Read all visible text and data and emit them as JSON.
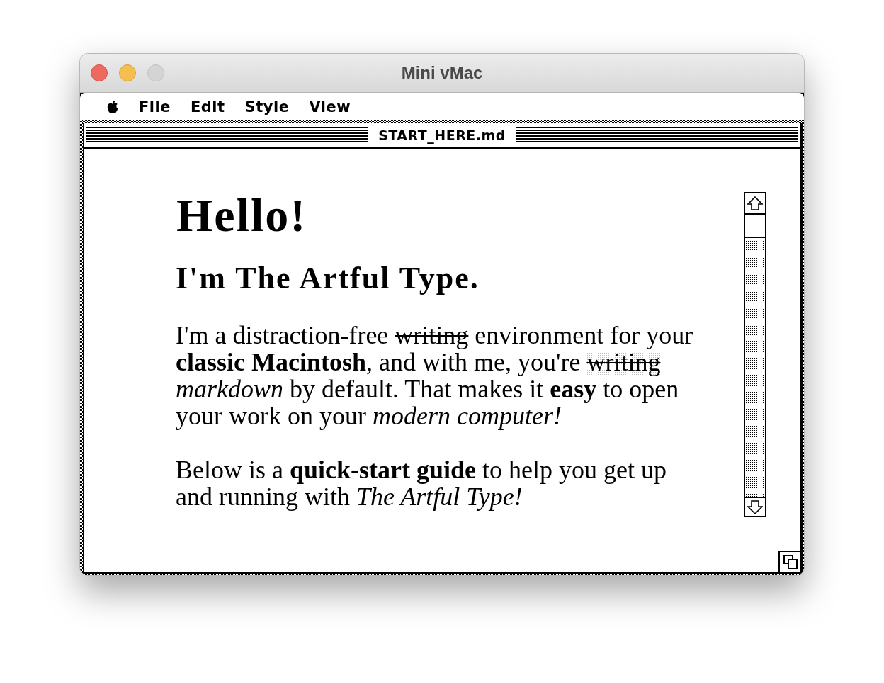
{
  "window": {
    "title": "Mini vMac",
    "zoom_enabled": false
  },
  "menu_bar": {
    "items": [
      "File",
      "Edit",
      "Style",
      "View"
    ]
  },
  "document": {
    "title": "START_HERE.md",
    "heading": "Hello!",
    "subheading": "I'm The Artful Type.",
    "paragraphs": [
      {
        "lines": [
          [
            {
              "text": "I'm a distraction-free ",
              "kind": "plain",
              "highlighted": false
            },
            {
              "text": "writing",
              "kind": "strike",
              "highlighted": false
            },
            {
              "text": " environment for your",
              "kind": "plain",
              "highlighted": false
            }
          ],
          [
            {
              "text": "classic Macintosh",
              "kind": "bold",
              "highlighted": false
            },
            {
              "text": ", and with me, you're ",
              "kind": "plain",
              "highlighted": false
            },
            {
              "text": "writing",
              "kind": "strike",
              "highlighted": true
            }
          ],
          [
            {
              "text": "markdown",
              "kind": "italic",
              "highlighted": false
            },
            {
              "text": " by default. That makes it ",
              "kind": "plain",
              "highlighted": false
            },
            {
              "text": "easy",
              "kind": "bold",
              "highlighted": false
            },
            {
              "text": " to open",
              "kind": "plain",
              "highlighted": false
            }
          ],
          [
            {
              "text": "your work on your ",
              "kind": "plain",
              "highlighted": false
            },
            {
              "text": "modern computer!",
              "kind": "italic",
              "highlighted": false
            }
          ]
        ]
      },
      {
        "lines": [
          [
            {
              "text": "Below is a ",
              "kind": "plain",
              "highlighted": false
            },
            {
              "text": "quick-start guide",
              "kind": "bold",
              "highlighted": false
            },
            {
              "text": " to help you get up",
              "kind": "plain",
              "highlighted": false
            }
          ],
          [
            {
              "text": "and running with ",
              "kind": "plain",
              "highlighted": false
            },
            {
              "text": "The Artful Type!",
              "kind": "italic",
              "highlighted": false
            }
          ]
        ]
      }
    ]
  }
}
